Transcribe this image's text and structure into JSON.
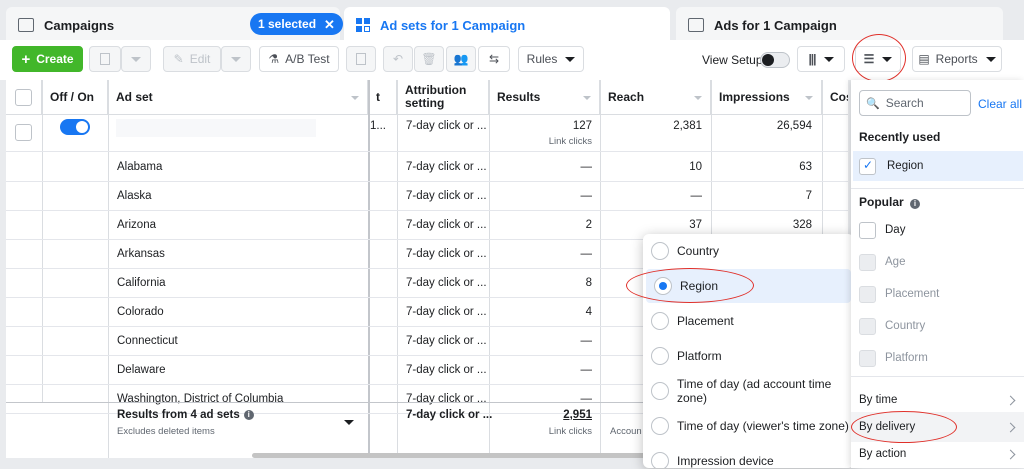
{
  "tabs": {
    "campaigns": "Campaigns",
    "selected_badge": "1 selected",
    "adsets": "Ad sets for 1 Campaign",
    "ads": "Ads for 1 Campaign"
  },
  "toolbar": {
    "create": "Create",
    "edit": "Edit",
    "ab_test": "A/B Test",
    "rules": "Rules",
    "view_setup": "View Setup",
    "reports": "Reports"
  },
  "table": {
    "headers": {
      "off_on": "Off / On",
      "ad_set": "Ad set",
      "t_col": "t",
      "attribution": "Attribution setting",
      "results": "Results",
      "reach": "Reach",
      "impressions": "Impressions",
      "cost": "Cost"
    },
    "first_row": {
      "cut": "1...",
      "attribution": "7-day click or ...",
      "results": "127",
      "results_sub": "Link clicks",
      "reach": "2,381",
      "impressions": "26,594"
    },
    "rows": [
      {
        "name": "Alabama",
        "attribution": "7-day click or ...",
        "results": "—",
        "reach": "10",
        "impressions": "63"
      },
      {
        "name": "Alaska",
        "attribution": "7-day click or ...",
        "results": "—",
        "reach": "—",
        "impressions": "7"
      },
      {
        "name": "Arizona",
        "attribution": "7-day click or ...",
        "results": "2",
        "reach": "37",
        "impressions": "328"
      },
      {
        "name": "Arkansas",
        "attribution": "7-day click or ...",
        "results": "—",
        "reach": "",
        "impressions": ""
      },
      {
        "name": "California",
        "attribution": "7-day click or ...",
        "results": "8",
        "reach": "",
        "impressions": ""
      },
      {
        "name": "Colorado",
        "attribution": "7-day click or ...",
        "results": "4",
        "reach": "",
        "impressions": ""
      },
      {
        "name": "Connecticut",
        "attribution": "7-day click or ...",
        "results": "—",
        "reach": "",
        "impressions": ""
      },
      {
        "name": "Delaware",
        "attribution": "7-day click or ...",
        "results": "—",
        "reach": "",
        "impressions": ""
      },
      {
        "name": "Washington, District of Columbia",
        "attribution": "7-day click or ...",
        "results": "—",
        "reach": "",
        "impressions": ""
      }
    ],
    "footer": {
      "title": "Results from 4 ad sets",
      "sub": "Excludes deleted items",
      "attribution": "7-day click or ...",
      "results": "2,951",
      "results_sub": "Link clicks",
      "reach_sub": "Accoun"
    }
  },
  "dropdown": {
    "items": [
      "Country",
      "Region",
      "Placement",
      "Platform",
      "Time of day (ad account time zone)",
      "Time of day (viewer's time zone)",
      "Impression device"
    ],
    "selected": "Region"
  },
  "panel": {
    "search_placeholder": "Search",
    "clear_all": "Clear all",
    "recently_used": "Recently used",
    "recent_item": "Region",
    "popular": "Popular",
    "popular_items": [
      "Day",
      "Age",
      "Placement",
      "Country",
      "Platform"
    ],
    "by_time": "By time",
    "by_delivery": "By delivery",
    "by_action": "By action"
  },
  "colors": {
    "accent": "#1877f2",
    "create_green": "#42b72a",
    "highlight_red": "#e0302a"
  }
}
